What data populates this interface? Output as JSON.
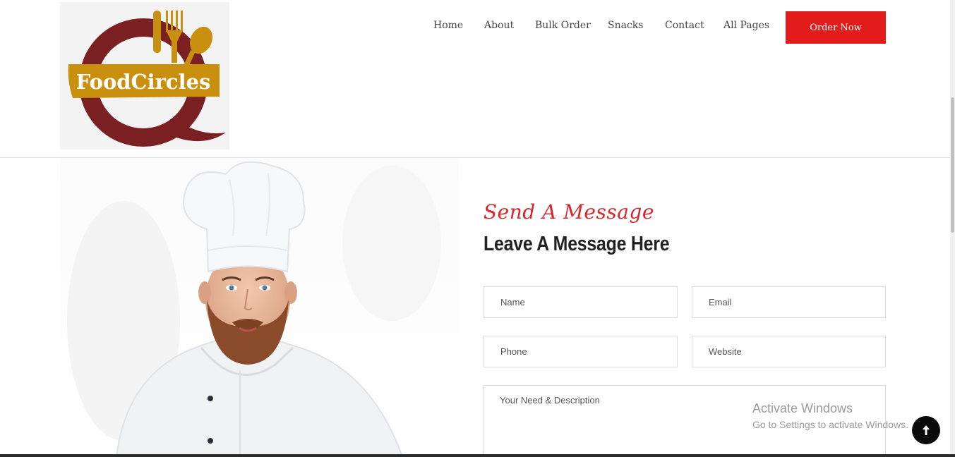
{
  "brand": {
    "name": "FoodCircles",
    "colors": {
      "ring": "#7a1f22",
      "gold": "#c8900e",
      "accent": "#e21b1b"
    }
  },
  "nav": {
    "items": [
      {
        "label": "Home"
      },
      {
        "label": "About"
      },
      {
        "label": "Bulk Order"
      },
      {
        "label": "Snacks"
      },
      {
        "label": "Contact"
      },
      {
        "label": "All Pages"
      }
    ],
    "cta_label": "Order Now"
  },
  "contact": {
    "subtitle": "Send A Message",
    "title": "Leave A Message Here",
    "fields": {
      "name": "Name",
      "email": "Email",
      "phone": "Phone",
      "website": "Website",
      "description": "Your Need & Description"
    }
  },
  "watermark": {
    "title": "Activate Windows",
    "subtitle": "Go to Settings to activate Windows."
  },
  "icons": {
    "back_to_top": "arrow-up-icon"
  }
}
